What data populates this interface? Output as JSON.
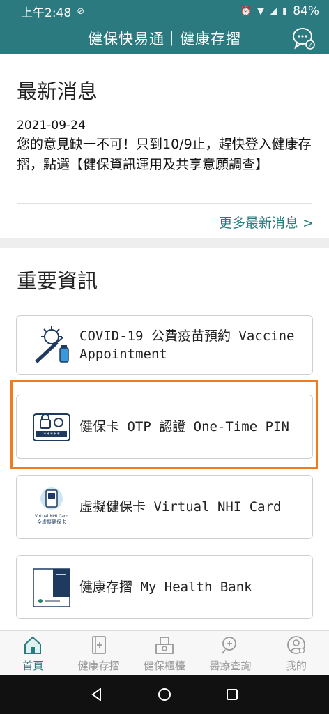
{
  "status_bar": {
    "time": "上午2:48",
    "battery": "84%"
  },
  "header": {
    "title": "健保快易通｜健康存摺"
  },
  "news": {
    "heading": "最新消息",
    "date": "2021-09-24",
    "body": "您的意見缺一不可！只到10/9止，趕快登入健康存摺，點選【健保資訊運用及共享意願調查】",
    "more_link": "更多最新消息 >"
  },
  "important": {
    "heading": "重要資訊",
    "cards": [
      {
        "label": "COVID-19 公費疫苗預約 Vaccine Appointment",
        "icon": "vaccine-icon"
      },
      {
        "label": "健保卡 OTP 認證 One-Time PIN",
        "icon": "otp-card-icon"
      },
      {
        "label": "虛擬健保卡 Virtual NHI Card",
        "icon": "virtual-card-icon"
      },
      {
        "label": "健康存摺 My Health Bank",
        "icon": "health-bank-book-icon"
      }
    ],
    "virtual_card_icon_text": "Virtual NHI Card 全虛擬健保卡"
  },
  "bottom_nav": [
    {
      "label": "首頁",
      "icon": "home-icon",
      "active": true
    },
    {
      "label": "健康存摺",
      "icon": "health-bank-icon",
      "active": false
    },
    {
      "label": "健保櫃檯",
      "icon": "counter-icon",
      "active": false
    },
    {
      "label": "醫療查詢",
      "icon": "medical-search-icon",
      "active": false
    },
    {
      "label": "我的",
      "icon": "profile-icon",
      "active": false
    }
  ],
  "colors": {
    "primary": "#2b7a7f",
    "highlight": "#f07c1e",
    "inactive": "#999999"
  }
}
